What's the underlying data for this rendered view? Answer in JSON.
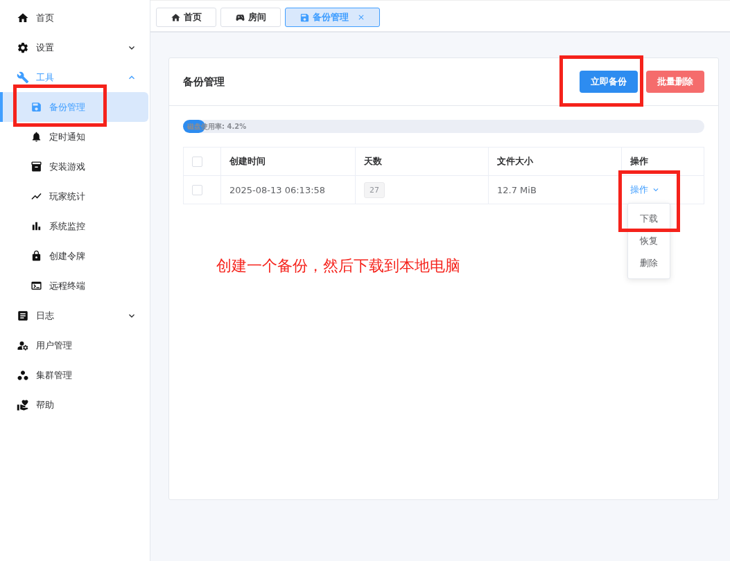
{
  "sidebar": {
    "items": [
      {
        "label": "首页",
        "selected": false
      },
      {
        "label": "设置",
        "selected": false,
        "expanded": false
      },
      {
        "label": "工具",
        "selected": true,
        "expanded": true,
        "children": [
          {
            "label": "备份管理",
            "selected": true,
            "highlighted": true
          },
          {
            "label": "定时通知",
            "selected": false
          },
          {
            "label": "安装游戏",
            "selected": false
          },
          {
            "label": "玩家统计",
            "selected": false
          },
          {
            "label": "系统监控",
            "selected": false
          },
          {
            "label": "创建令牌",
            "selected": false
          },
          {
            "label": "远程终端",
            "selected": false
          }
        ]
      },
      {
        "label": "日志",
        "selected": false,
        "expanded": false
      },
      {
        "label": "用户管理",
        "selected": false
      },
      {
        "label": "集群管理",
        "selected": false
      },
      {
        "label": "帮助",
        "selected": false
      }
    ]
  },
  "tabs": [
    {
      "label": "首页",
      "selected": false,
      "closable": false
    },
    {
      "label": "房间",
      "selected": false,
      "closable": false
    },
    {
      "label": "备份管理",
      "selected": true,
      "closable": true
    }
  ],
  "card": {
    "title": "备份管理",
    "buttons": [
      {
        "label": "立即备份",
        "kind": "primary",
        "highlighted": true
      },
      {
        "label": "批量删除",
        "kind": "danger"
      }
    ],
    "disk_usage": {
      "label": "磁盘使用率: 4.2%",
      "level": 0.042
    },
    "table": {
      "columns": [
        "创建时间",
        "天数",
        "文件大小",
        "操作"
      ],
      "header_checked": false,
      "rows": [
        {
          "checked": false,
          "created": "2025-08-13 06:13:58",
          "days": "27",
          "size": "12.7 MiB",
          "action": "操作"
        }
      ]
    },
    "action_menu": {
      "highlighted": true,
      "items": [
        {
          "label": "下载"
        },
        {
          "label": "恢复"
        },
        {
          "label": "删除"
        }
      ]
    },
    "annotation": "创建一个备份，然后下载到本地电脑"
  }
}
